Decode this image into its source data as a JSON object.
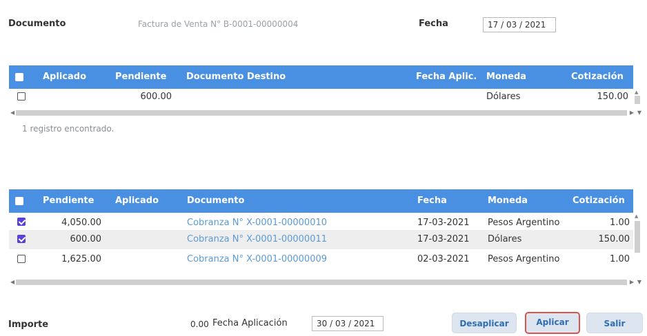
{
  "header": {
    "documento_label": "Documento",
    "documento_value": "Factura de Venta N° B-0001-00000004",
    "fecha_label": "Fecha",
    "fecha_value": "17 /  03 / 2021"
  },
  "grid1": {
    "columns": [
      "Aplicado",
      "Pendiente",
      "Documento Destino",
      "Fecha Aplic.",
      "Moneda",
      "Cotización"
    ],
    "rows": [
      {
        "checked": false,
        "aplicado": "",
        "pendiente": "600.00",
        "documento_destino": "",
        "fecha_aplic": "",
        "moneda": "Dólares",
        "cotizacion": "150.00"
      }
    ],
    "record_count": "1 registro encontrado."
  },
  "grid2": {
    "columns": [
      "Pendiente",
      "Aplicado",
      "Documento",
      "Fecha",
      "Moneda",
      "Cotización"
    ],
    "rows": [
      {
        "checked": true,
        "pendiente": "4,050.00",
        "aplicado": "",
        "documento": "Cobranza N° X-0001-00000010",
        "fecha": "17-03-2021",
        "moneda": "Pesos Argentinos",
        "cotizacion": "1.00"
      },
      {
        "checked": true,
        "pendiente": "600.00",
        "aplicado": "",
        "documento": "Cobranza N° X-0001-00000011",
        "fecha": "17-03-2021",
        "moneda": "Dólares",
        "cotizacion": "150.00"
      },
      {
        "checked": false,
        "pendiente": "1,625.00",
        "aplicado": "",
        "documento": "Cobranza N° X-0001-00000009",
        "fecha": "02-03-2021",
        "moneda": "Pesos Argentinos",
        "cotizacion": "1.00"
      }
    ]
  },
  "footer": {
    "importe_label": "Importe",
    "importe_value": "0.00",
    "fecha_aplicacion_label": "Fecha Aplicación",
    "fecha_aplicacion_value": "30 /  03 / 2021",
    "btn_desaplicar": "Desaplicar",
    "btn_aplicar": "Aplicar",
    "btn_salir": "Salir"
  },
  "colors": {
    "header_blue": "#4a90e2",
    "link_blue": "#5b9bd5",
    "checkbox_checked": "#5a3fd9",
    "focus_border": "#d9534f"
  }
}
